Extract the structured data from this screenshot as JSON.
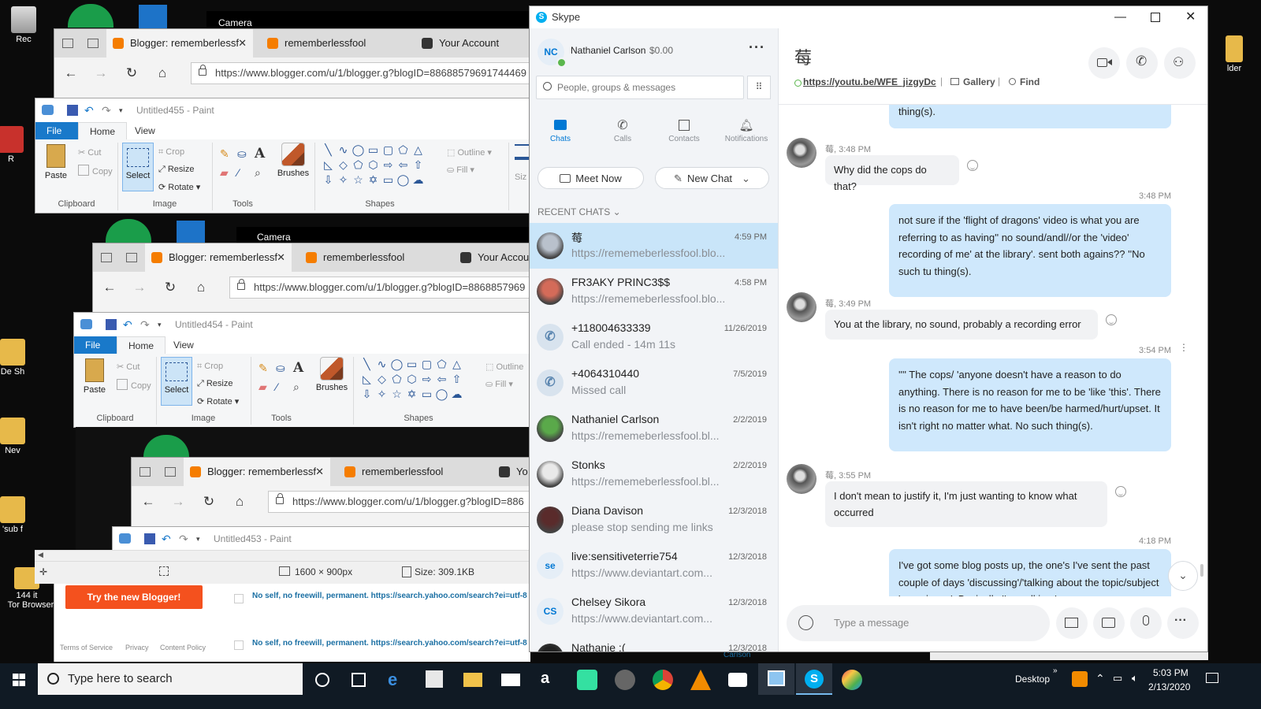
{
  "desktop": {
    "icons": [
      {
        "label": "Rec"
      },
      {
        "label": "R"
      },
      {
        "label": "De Sh"
      },
      {
        "label": "Nev"
      },
      {
        "label": "'sub f"
      },
      {
        "label": "144 it"
      },
      {
        "label": "Tor Browser"
      }
    ],
    "right_icon_label": "lder"
  },
  "browser1": {
    "tabs": [
      "Blogger: rememberlessf",
      "rememberlessfool",
      "Your Account"
    ],
    "url": "https://www.blogger.com/u/1/blogger.g?blogID=88688579691744469"
  },
  "browser2": {
    "tabs": [
      "Blogger: rememberlessf",
      "rememberlessfool",
      "Your Accou"
    ],
    "url": "https://www.blogger.com/u/1/blogger.g?blogID=8868857969"
  },
  "browser3": {
    "tabs": [
      "Blogger: rememberlessf",
      "rememberlessfool",
      "Yo"
    ],
    "url": "https://www.blogger.com/u/1/blogger.g?blogID=886"
  },
  "camera_label": "Camera",
  "paint1": {
    "title": "Untitled455 - Paint",
    "ribbon_tabs": [
      "File",
      "Home",
      "View"
    ],
    "groups": [
      "Clipboard",
      "Image",
      "Tools",
      "Shapes"
    ],
    "items": {
      "paste": "Paste",
      "cut": "Cut",
      "copy": "Copy",
      "select": "Select",
      "crop": "Crop",
      "resize": "Resize",
      "rotate": "Rotate",
      "brushes": "Brushes",
      "outline": "Outline",
      "fill": "Fill",
      "size": "Siz"
    }
  },
  "paint2": {
    "title": "Untitled454 - Paint",
    "ribbon_tabs": [
      "File",
      "Home",
      "View"
    ],
    "groups": [
      "Clipboard",
      "Image",
      "Tools",
      "Shapes"
    ],
    "items": {
      "paste": "Paste",
      "cut": "Cut",
      "copy": "Copy",
      "select": "Select",
      "crop": "Crop",
      "resize": "Resize",
      "rotate": "Rotate",
      "brushes": "Brushes",
      "outline": "Outline",
      "fill": "Fill"
    }
  },
  "paint3": {
    "title": "Untitled453 - Paint"
  },
  "paint_status": {
    "dimensions": "1600 × 900px",
    "size": "Size: 309.1KB"
  },
  "blogger": {
    "try_button": "Try the new Blogger!",
    "post_title_1": "No self, no freewill, permanent. https://search.yahoo.com/search?ei=utf-8",
    "post_title_2": "No self, no freewill, permanent. https://search.yahoo.com/search?ei=utf-8",
    "footer": [
      "Terms of Service",
      "Privacy",
      "Content Policy"
    ],
    "bottom_label": "Carlson"
  },
  "skype": {
    "app_title": "Skype",
    "profile": {
      "initials": "NC",
      "name": "Nathaniel Carlson",
      "balance": "$0.00"
    },
    "search_placeholder": "People, groups & messages",
    "nav": [
      {
        "label": "Chats",
        "icon": "chat-icon",
        "active": true
      },
      {
        "label": "Calls",
        "icon": "phone-icon",
        "active": false
      },
      {
        "label": "Contacts",
        "icon": "contacts-icon",
        "active": false
      },
      {
        "label": "Notifications",
        "icon": "bell-icon",
        "active": false
      }
    ],
    "meet_now": "Meet Now",
    "new_chat": "New Chat",
    "recent_chats_label": "RECENT CHATS",
    "chats": [
      {
        "name": "莓",
        "preview": "https://rememeberlessfool.blo...",
        "time": "4:59 PM",
        "selected": true,
        "avatar": "photo"
      },
      {
        "name": "FR3AKY PRINC3$$",
        "preview": "https://rememeberlessfool.blo...",
        "time": "4:58 PM",
        "selected": false,
        "avatar": "photo"
      },
      {
        "name": "+118004633339",
        "preview": "Call ended - 14m 11s",
        "time": "11/26/2019",
        "selected": false,
        "avatar": "phone"
      },
      {
        "name": "+4064310440",
        "preview": "Missed call",
        "time": "7/5/2019",
        "selected": false,
        "avatar": "phone"
      },
      {
        "name": "Nathaniel Carlson",
        "preview": "https://rememeberlessfool.bl...",
        "time": "2/2/2019",
        "selected": false,
        "avatar": "photo"
      },
      {
        "name": "Stonks",
        "preview": "https://rememeberlessfool.bl...",
        "time": "2/2/2019",
        "selected": false,
        "avatar": "photo"
      },
      {
        "name": "Diana Davison",
        "preview": "please stop sending me links",
        "time": "12/3/2018",
        "selected": false,
        "avatar": "photo"
      },
      {
        "name": "live:sensitiveterrie754",
        "preview": "https://www.deviantart.com...",
        "time": "12/3/2018",
        "selected": false,
        "avatar": "se"
      },
      {
        "name": "Chelsey Sikora",
        "preview": "https://www.deviantart.com...",
        "time": "12/3/2018",
        "selected": false,
        "avatar": "CS"
      },
      {
        "name": "Nathanie :(",
        "preview": "",
        "time": "12/3/2018",
        "selected": false,
        "avatar": "photo"
      }
    ],
    "conversation": {
      "contact_glyph": "莓",
      "link": "https://youtu.be/WFE_jizgyDc",
      "gallery": "Gallery",
      "find": "Find",
      "messages": [
        {
          "dir": "out",
          "text": "thing(s).",
          "time": ""
        },
        {
          "dir": "in",
          "sender": "莓",
          "time": "3:48 PM",
          "text": "Why did the cops do that?"
        },
        {
          "dir": "out",
          "time": "3:48 PM",
          "text": "not sure if the 'flight of dragons' video is what you are referring to as having'' no sound/andl//or the 'video' recording of me' at the library'. sent both agains?? ''No such tu thing(s)."
        },
        {
          "dir": "in",
          "sender": "莓",
          "time": "3:49 PM",
          "text": "You at the library, no sound, probably a recording error"
        },
        {
          "dir": "out",
          "time": "3:54 PM",
          "text": "'''' The cops/ 'anyone doesn't have a reason to do anything. There is no reason for me to be 'like 'this'. There is no reason for me to have been/be harmed/hurt/upset. It isn't right no matter what. No such thing(s)."
        },
        {
          "dir": "in",
          "sender": "莓",
          "time": "3:55 PM",
          "text": "I don't mean to justify it, I'm just wanting to know what occurred"
        },
        {
          "dir": "out",
          "time": "4:18 PM",
          "text": "I've got some blog posts up, the one's I've sent the past couple of days 'discussing'/'talking about the topic/subject 'experience'. Basically I'm walking ' a"
        }
      ],
      "compose_placeholder": "Type a message"
    }
  },
  "taskbar": {
    "search_placeholder": "Type here to search",
    "desktop_label": "Desktop",
    "time": "5:03 PM",
    "date": "2/13/2020"
  },
  "colors": {
    "skype_blue": "#0078d4",
    "bubble_out": "#cfe8fc",
    "bubble_in": "#f1f2f4",
    "paint_file": "#1979ca",
    "blogger_orange": "#f4511e",
    "taskbar": "#101a24"
  }
}
